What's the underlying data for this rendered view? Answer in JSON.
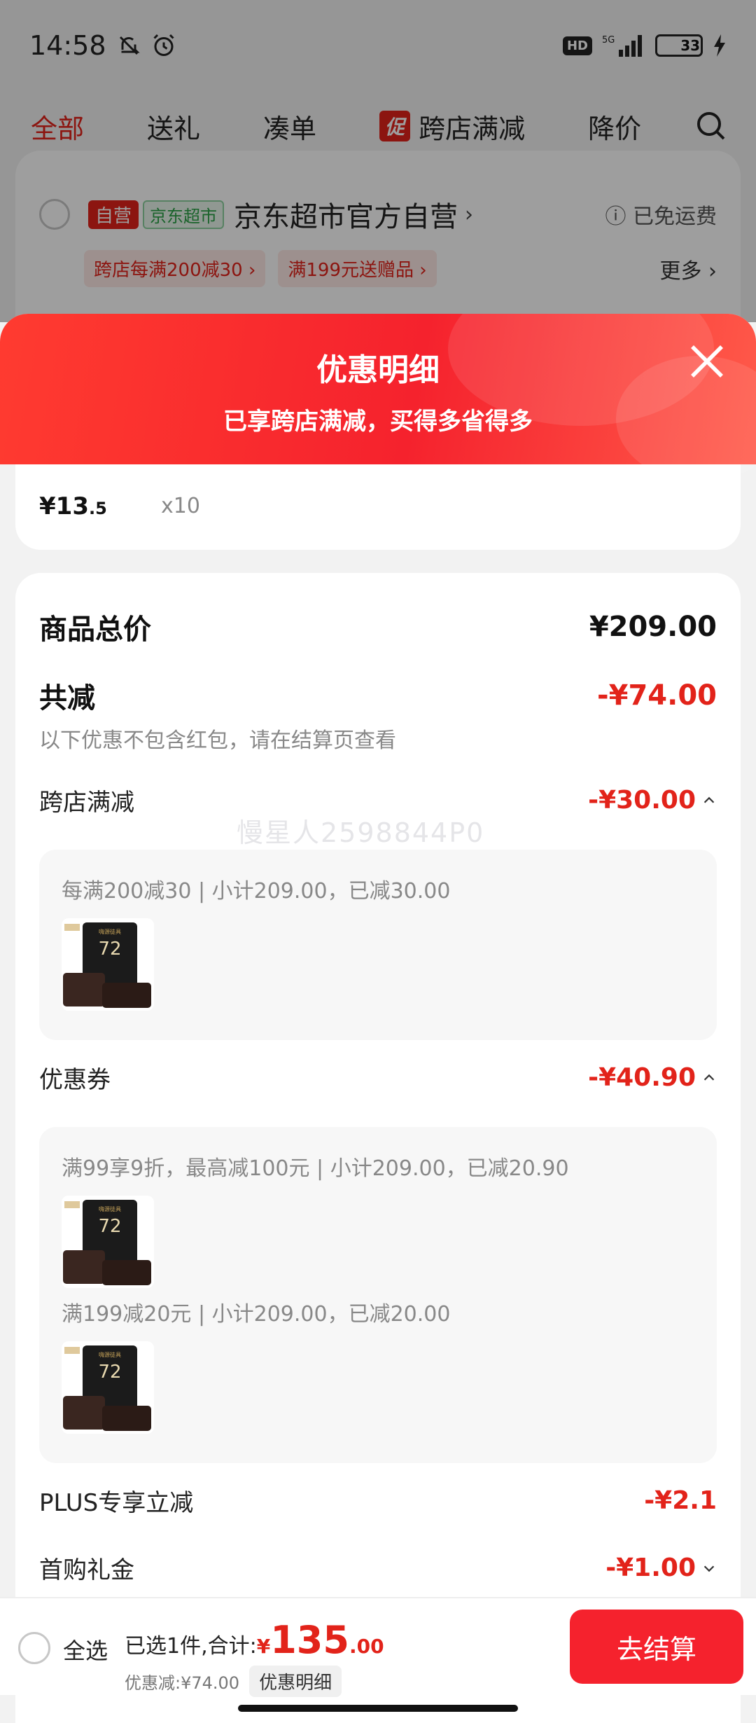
{
  "status": {
    "time": "14:58",
    "network": "5G",
    "battery": "33",
    "hd": "HD"
  },
  "tabs": [
    {
      "label": "全部",
      "active": true
    },
    {
      "label": "送礼"
    },
    {
      "label": "凑单"
    },
    {
      "label": "跨店满减",
      "chip": "促"
    },
    {
      "label": "降价"
    }
  ],
  "store": {
    "self_tag": "自营",
    "jd_tag": "京东超市",
    "name": "京东超市官方自营",
    "shipping": "已免运费",
    "promos": [
      "跨店每满200减30",
      "满199元送赠品"
    ],
    "more": "更多"
  },
  "sheet": {
    "title": "优惠明细",
    "subtitle": "已享跨店满减，买得多省得多"
  },
  "item": {
    "price_int": "¥13",
    "price_dec": ".5",
    "qty": "x10"
  },
  "detail": {
    "total_label": "商品总价",
    "total_value": "¥209.00",
    "reduce_label": "共减",
    "reduce_value": "-¥74.00",
    "reduce_note": "以下优惠不包含红包，请在结算页查看",
    "cross_label": "跨店满减",
    "cross_value": "-¥30.00",
    "cross_detail": "每满200减30 | 小计209.00，已减30.00",
    "coupon_label": "优惠券",
    "coupon_value": "-¥40.90",
    "coupon_detail_1": "满99享9折，最高减100元 | 小计209.00，已减20.90",
    "coupon_detail_2": "满199减20元 | 小计209.00，已减20.00",
    "plus_label": "PLUS专享立减",
    "plus_value": "-¥2.1",
    "first_label": "首购礼金",
    "first_value": "-¥1.00"
  },
  "product_thumb": {
    "brand": "嗨源徒具",
    "badge": "72"
  },
  "watermark": "慢星人2598844P0",
  "bottom": {
    "select_all": "全选",
    "summary": "已选1件,合计:",
    "currency": "¥",
    "total_int": "135",
    "total_dec": ".00",
    "saved": "优惠减:¥74.00",
    "detail_btn": "优惠明细",
    "checkout": "去结算"
  },
  "colors": {
    "accent": "#e2231a",
    "header_red": "#f5222d"
  }
}
